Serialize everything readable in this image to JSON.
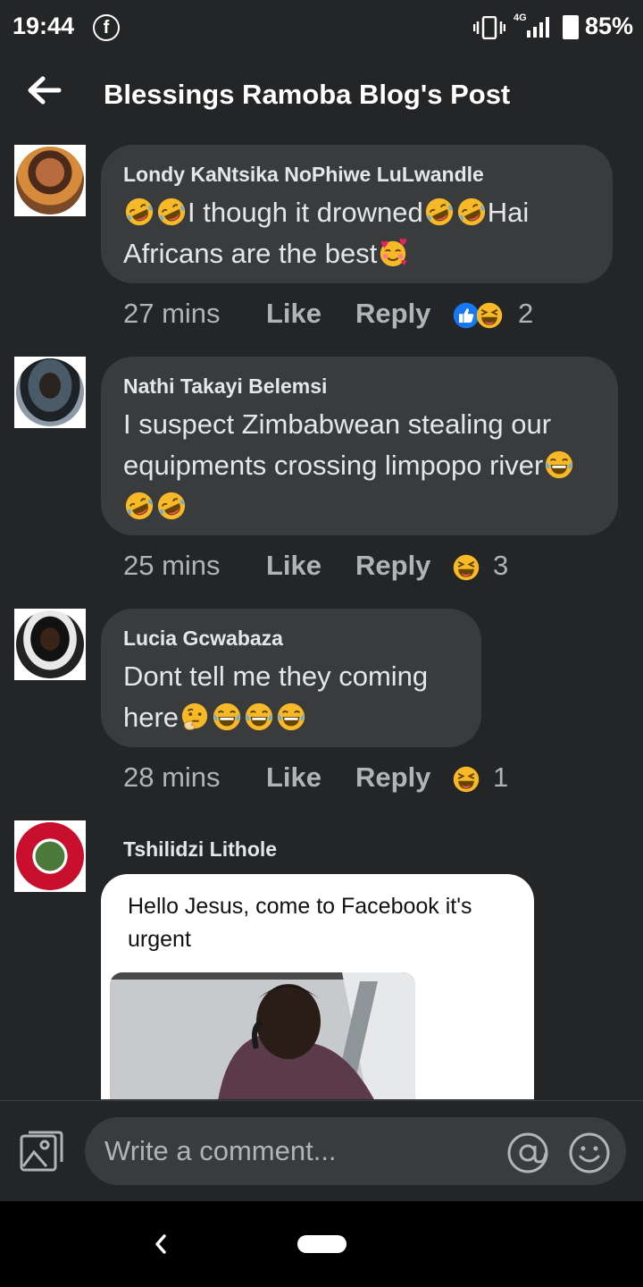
{
  "status_bar": {
    "time": "19:44",
    "network": "4G",
    "battery": "85%"
  },
  "header": {
    "title": "Blessings Ramoba Blog's Post"
  },
  "comments": [
    {
      "author": "Londy KaNtsika NoPhiwe LuLwandle",
      "parts": [
        "I though it drowned",
        "Hai Africans are the best"
      ],
      "time": "27 mins",
      "like": "Like",
      "reply": "Reply",
      "reaction_count": "2"
    },
    {
      "author": "Nathi Takayi Belemsi",
      "parts": [
        "I suspect Zimbabwean stealing our equipments crossing limpopo river"
      ],
      "time": "25 mins",
      "like": "Like",
      "reply": "Reply",
      "reaction_count": "3"
    },
    {
      "author": "Lucia Gcwabaza",
      "parts": [
        "Dont tell me they coming here"
      ],
      "time": "28 mins",
      "like": "Like",
      "reply": "Reply",
      "reaction_count": "1"
    },
    {
      "author": "Tshilidzi Lithole",
      "image_caption": "Hello Jesus,  come to Facebook it's urgent"
    }
  ],
  "composer": {
    "placeholder": "Write a comment..."
  },
  "colors": {
    "background": "#242526",
    "bubble": "#3a3b3c",
    "like_blue": "#1877f2",
    "emoji_yellow": "#f7b928"
  },
  "icons": [
    "facebook-icon",
    "vibrate-icon",
    "signal-icon",
    "battery-icon",
    "back-arrow-icon",
    "rofl-emoji-icon",
    "smiling-hearts-emoji-icon",
    "joy-emoji-icon",
    "thinking-emoji-icon",
    "like-reaction-icon",
    "haha-reaction-icon",
    "photo-icon",
    "at-sign-icon",
    "emoji-icon",
    "nav-back-icon"
  ]
}
